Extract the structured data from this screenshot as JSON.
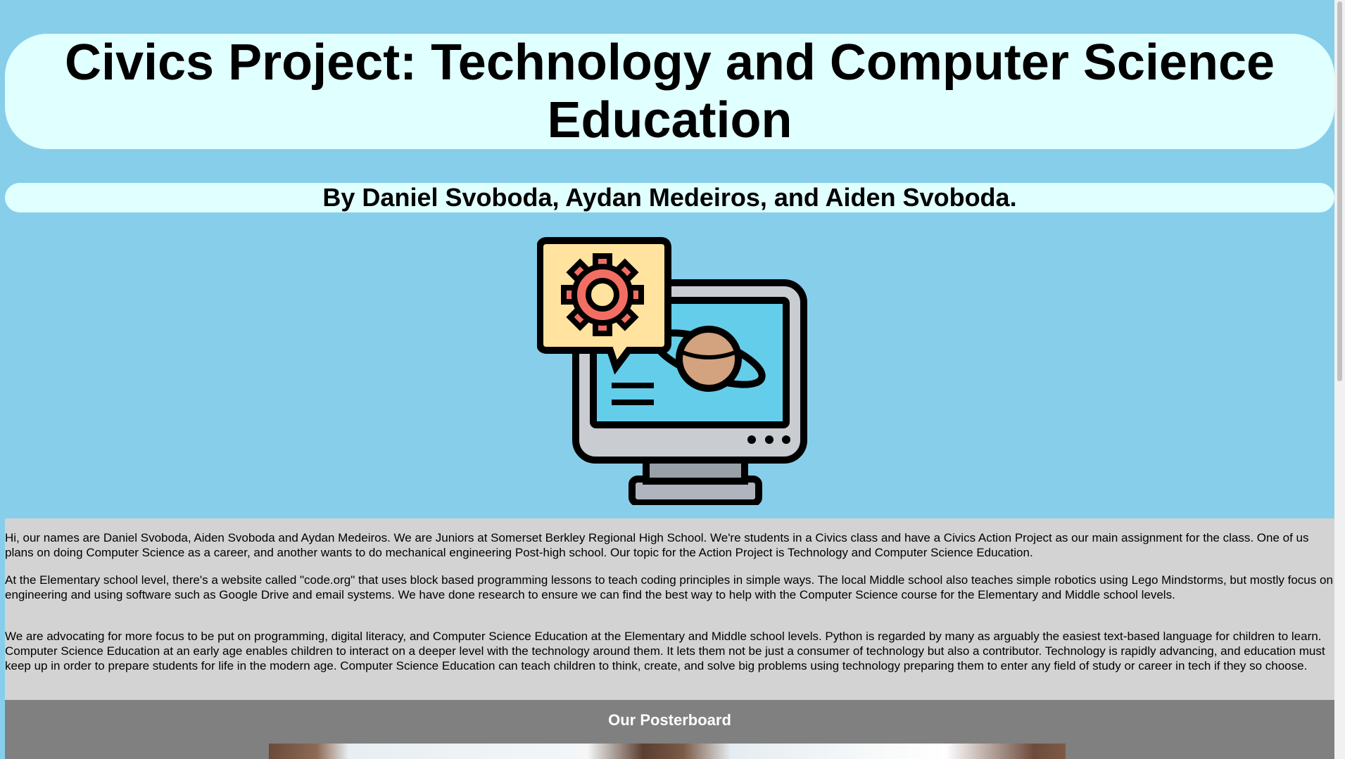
{
  "header": {
    "title": "Civics Project: Technology and Computer Science Education",
    "byline": "By Daniel Svoboda, Aydan Medeiros, and Aiden Svoboda."
  },
  "logo": {
    "icon": "computer-gear-planet-icon"
  },
  "intro": {
    "paragraphs": [
      "Hi, our names are Daniel Svoboda, Aiden Svoboda and Aydan Medeiros. We are Juniors at Somerset Berkley Regional High School. We're students in a Civics class and have a Civics Action Project as our main assignment for the class. One of us plans on doing Computer Science as a career, and another wants to do mechanical engineering Post-high school. Our topic for the Action Project is Technology and Computer Science Education.",
      "At the Elementary school level, there's a website called \"code.org\" that uses block based programming lessons to teach coding principles in simple ways. The local Middle school also teaches simple robotics using Lego Mindstorms, but mostly focus on engineering and using software such as Google Drive and email systems. We have done research to ensure we can find the best way to help with the Computer Science course for the Elementary and Middle school levels.",
      "We are advocating for more focus to be put on programming, digital literacy, and Computer Science Education at the Elementary and Middle school levels. Python is regarded by many as arguably the easiest text-based language for children to learn. Computer Science Education at an early age enables children to interact on a deeper level with the technology around them. It lets them not be just a consumer of technology but also a contributor. Technology is rapidly advancing, and education must keep up in order to prepare students for life in the modern age. Computer Science Education can teach children to think, create, and solve big problems using technology preparing them to enter any field of study or career in tech if they so choose."
    ]
  },
  "posterboard": {
    "heading": "Our Posterboard"
  },
  "colors": {
    "page_background": "#87ceeb",
    "title_box": "#e0ffff",
    "text_panel": "#d3d3d3",
    "poster_section": "#808080"
  }
}
